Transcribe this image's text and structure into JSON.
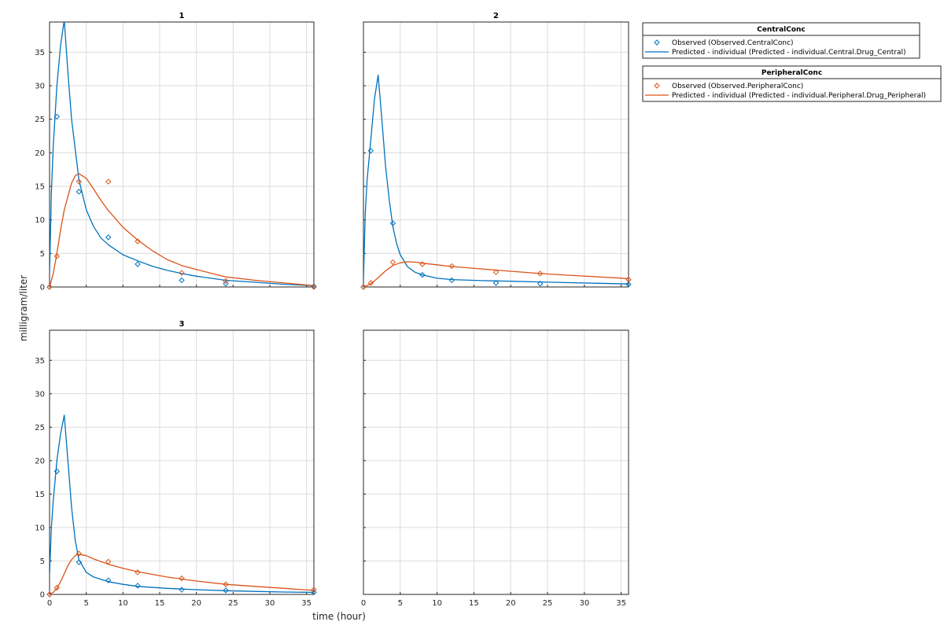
{
  "colors": {
    "central": "#0072BD",
    "peripheral": "#D95319",
    "grid": "#dcdcdc",
    "axis": "#262626"
  },
  "chart_data": {
    "type": "line",
    "xlabel": "time (hour)",
    "ylabel": "milligram/liter",
    "xlim": [
      0,
      36
    ],
    "ylim": [
      0,
      39.5
    ],
    "x_ticks": [
      0,
      5,
      10,
      15,
      20,
      25,
      30,
      35
    ],
    "y_ticks": [
      0,
      5,
      10,
      15,
      20,
      25,
      30,
      35
    ],
    "grid": true,
    "legend_position": "right",
    "legend": [
      {
        "title": "CentralConc",
        "entries": [
          {
            "kind": "marker",
            "label": "Observed (Observed.CentralConc)",
            "color_key": "central"
          },
          {
            "kind": "line",
            "label": "Predicted - individual (Predicted - individual.Central.Drug_Central)",
            "color_key": "central"
          }
        ]
      },
      {
        "title": "PeripheralConc",
        "entries": [
          {
            "kind": "marker",
            "label": "Observed (Observed.PeripheralConc)",
            "color_key": "peripheral"
          },
          {
            "kind": "line",
            "label": "Predicted - individual (Predicted - individual.Peripheral.Drug_Peripheral)",
            "color_key": "peripheral"
          }
        ]
      }
    ],
    "panels": [
      {
        "title": "1",
        "series": [
          {
            "key": "central_obs",
            "kind": "marker",
            "color_key": "central",
            "x": [
              0,
              1,
              4,
              8,
              12,
              18,
              24,
              36
            ],
            "y": [
              0,
              25.4,
              14.2,
              7.4,
              3.4,
              1.0,
              0.5,
              0.1
            ]
          },
          {
            "key": "central_pred",
            "kind": "line",
            "color_key": "central",
            "x": [
              0,
              0.25,
              0.5,
              1,
              1.5,
              2,
              2.5,
              3,
              4,
              5,
              6,
              7,
              8,
              10,
              12,
              14,
              16,
              18,
              20,
              24,
              28,
              32,
              36
            ],
            "y": [
              2,
              14,
              21,
              30,
              36,
              39.8,
              32,
              25,
              16,
              11.5,
              9,
              7.3,
              6.3,
              4.8,
              3.9,
              3.1,
              2.5,
              2.0,
              1.6,
              1.0,
              0.7,
              0.4,
              0.2
            ]
          },
          {
            "key": "peripheral_obs",
            "kind": "marker",
            "color_key": "peripheral",
            "x": [
              0,
              1,
              4,
              8,
              12,
              18,
              24,
              36
            ],
            "y": [
              0,
              4.6,
              15.7,
              15.7,
              6.8,
              2.1,
              0.9,
              0
            ]
          },
          {
            "key": "peripheral_pred",
            "kind": "line",
            "color_key": "peripheral",
            "x": [
              0,
              0.5,
              1,
              1.5,
              2,
              3,
              3.5,
              4,
              5,
              6,
              7,
              8,
              10,
              12,
              14,
              16,
              18,
              20,
              24,
              28,
              32,
              36
            ],
            "y": [
              0,
              2,
              5,
              8.5,
              11.5,
              15.5,
              16.6,
              16.9,
              16.2,
              14.6,
              12.9,
              11.4,
              8.9,
              7.0,
              5.4,
              4.1,
              3.2,
              2.6,
              1.5,
              1.0,
              0.6,
              0.2
            ]
          }
        ]
      },
      {
        "title": "2",
        "series": [
          {
            "key": "central_obs",
            "kind": "marker",
            "color_key": "central",
            "x": [
              0,
              1,
              4,
              8,
              12,
              18,
              24,
              36
            ],
            "y": [
              0,
              20.3,
              9.5,
              1.8,
              1.0,
              0.6,
              0.5,
              0.4
            ]
          },
          {
            "key": "central_pred",
            "kind": "line",
            "color_key": "central",
            "x": [
              0,
              0.25,
              0.5,
              1,
              1.5,
              2,
              2.5,
              3,
              3.5,
              4,
              4.5,
              5,
              6,
              7,
              8,
              10,
              12,
              16,
              20,
              24,
              28,
              32,
              36
            ],
            "y": [
              1,
              11,
              16,
              22,
              28,
              31.6,
              25,
              18,
              13,
              9,
              6.5,
              4.8,
              3,
              2.2,
              1.8,
              1.3,
              1.1,
              0.95,
              0.85,
              0.75,
              0.65,
              0.55,
              0.45
            ]
          },
          {
            "key": "peripheral_obs",
            "kind": "marker",
            "color_key": "peripheral",
            "x": [
              0,
              1,
              4,
              8,
              12,
              18,
              24,
              36
            ],
            "y": [
              0,
              0.6,
              3.7,
              3.4,
              3.1,
              2.2,
              2.0,
              1.1
            ]
          },
          {
            "key": "peripheral_pred",
            "kind": "line",
            "color_key": "peripheral",
            "x": [
              0,
              0.5,
              1,
              1.5,
              2,
              3,
              4,
              5,
              6,
              7,
              8,
              10,
              12,
              16,
              20,
              24,
              28,
              32,
              36
            ],
            "y": [
              0,
              0.2,
              0.5,
              0.9,
              1.4,
              2.4,
              3.2,
              3.6,
              3.75,
              3.7,
              3.55,
              3.3,
              3.05,
              2.7,
              2.35,
              2.0,
              1.75,
              1.5,
              1.25
            ]
          }
        ]
      },
      {
        "title": "3",
        "series": [
          {
            "key": "central_obs",
            "kind": "marker",
            "color_key": "central",
            "x": [
              0,
              1,
              4,
              8,
              12,
              18,
              24,
              36
            ],
            "y": [
              0,
              18.4,
              4.8,
              2.1,
              1.3,
              0.7,
              0.6,
              0.3
            ]
          },
          {
            "key": "central_pred",
            "kind": "line",
            "color_key": "central",
            "x": [
              0,
              0.25,
              0.5,
              1,
              1.5,
              2,
              2.5,
              3,
              3.5,
              4,
              5,
              6,
              8,
              10,
              12,
              16,
              20,
              24,
              28,
              32,
              36
            ],
            "y": [
              3,
              10,
              14,
              20,
              24,
              26.8,
              20,
              13,
              8,
              5.2,
              3.3,
              2.6,
              1.9,
              1.5,
              1.2,
              0.9,
              0.7,
              0.55,
              0.45,
              0.35,
              0.3
            ]
          },
          {
            "key": "peripheral_obs",
            "kind": "marker",
            "color_key": "peripheral",
            "x": [
              0,
              1,
              4,
              8,
              12,
              18,
              24,
              36
            ],
            "y": [
              0,
              1.0,
              6.1,
              4.9,
              3.3,
              2.4,
              1.5,
              0.7
            ]
          },
          {
            "key": "peripheral_pred",
            "kind": "line",
            "color_key": "peripheral",
            "x": [
              0,
              0.5,
              1,
              1.5,
              2,
              2.5,
              3,
              3.5,
              4,
              5,
              6,
              8,
              10,
              12,
              16,
              20,
              24,
              28,
              32,
              36
            ],
            "y": [
              0,
              0.3,
              0.9,
              1.9,
              3.1,
              4.3,
              5.2,
              5.8,
              6.0,
              5.8,
              5.3,
              4.5,
              3.9,
              3.4,
              2.6,
              2.0,
              1.5,
              1.2,
              0.9,
              0.6
            ]
          }
        ]
      },
      {
        "title": "",
        "series": []
      }
    ]
  }
}
